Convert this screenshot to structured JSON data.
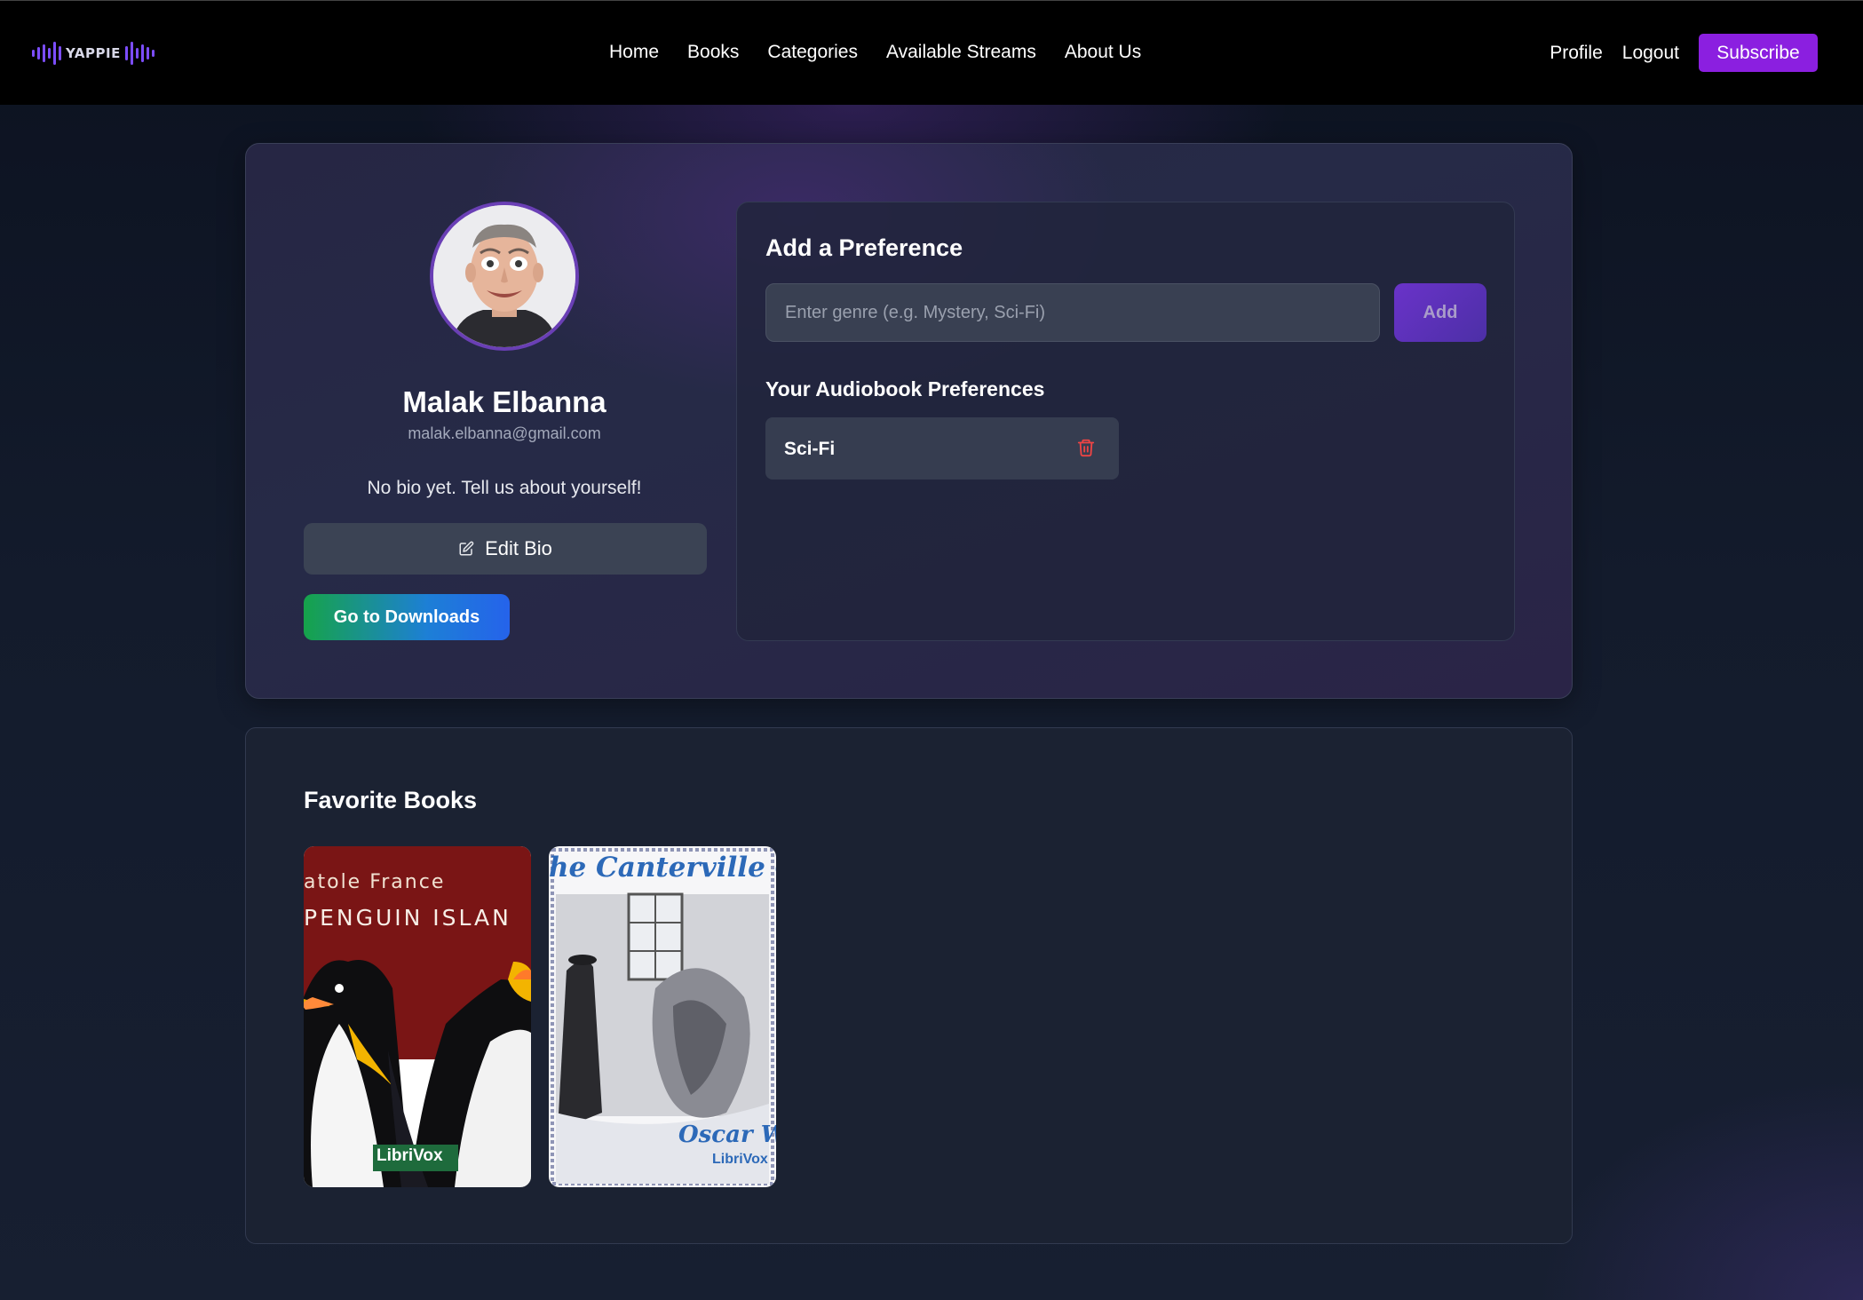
{
  "nav": {
    "logo_text": "YAPPIE",
    "links": [
      "Home",
      "Books",
      "Categories",
      "Available Streams",
      "About Us"
    ],
    "profile": "Profile",
    "logout": "Logout",
    "subscribe": "Subscribe"
  },
  "profile": {
    "name": "Malak Elbanna",
    "email": "malak.elbanna@gmail.com",
    "bio": "No bio yet. Tell us about yourself!",
    "edit_bio": "Edit Bio",
    "downloads": "Go to Downloads"
  },
  "preferences": {
    "title": "Add a Preference",
    "input_placeholder": "Enter genre (e.g. Mystery, Sci-Fi)",
    "add": "Add",
    "list_title": "Your Audiobook Preferences",
    "items": [
      "Sci-Fi"
    ]
  },
  "favorites": {
    "title": "Favorite Books",
    "books": [
      {
        "author_text": "atole France",
        "title_text": "PENGUIN ISLAN",
        "badge": "LibriVox"
      },
      {
        "title_text": "he Canterville Ghos",
        "author_text": "Oscar Wil",
        "badge": "LibriVox"
      }
    ]
  },
  "colors": {
    "accent": "#8b1fe0",
    "trash": "#ef4444",
    "background": "#0f1626"
  }
}
